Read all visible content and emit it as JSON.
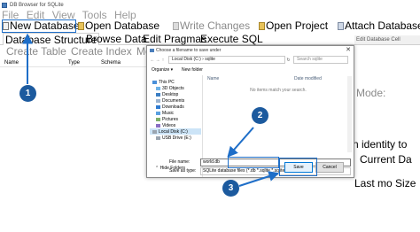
{
  "window": {
    "title": "DB Browser for SQLite"
  },
  "menubar": [
    "File",
    "Edit",
    "View",
    "Tools",
    "Help"
  ],
  "toolbar": {
    "new_database": "New Database",
    "open_database": "Open Database",
    "write_changes": "Write Changes",
    "open_project": "Open Project",
    "attach_database": "Attach Database"
  },
  "tabs": [
    "Database Structure",
    "Browse Data",
    "Edit Pragmas",
    "Execute SQL"
  ],
  "subtoolbar": {
    "create_table": "Create Table",
    "create_index": "Create Index",
    "modify": "Mo"
  },
  "columns": {
    "name": "Name",
    "type": "Type",
    "schema": "Schema"
  },
  "right_pane": {
    "header": "Edit Database Cell",
    "frag_mode": "Mode:",
    "frag_identity": "n identity to",
    "frag_current": "Current Da",
    "frag_last": "Last mo Size"
  },
  "dialog": {
    "title": "Choose a filename to save under",
    "path": "Local Disk (C:) › sqlite",
    "search_placeholder": "Search sqlite",
    "organize": "Organize ▾",
    "new_folder": "New folder",
    "nav_items": [
      "This PC",
      "3D Objects",
      "Desktop",
      "Documents",
      "Downloads",
      "Music",
      "Pictures",
      "Videos",
      "Local Disk (C:)",
      "USB Drive (E:)"
    ],
    "file_headers": {
      "name": "Name",
      "date_modified": "Date modified"
    },
    "empty_message": "No items match your search.",
    "file_name_label": "File name:",
    "file_name_value": "world.db",
    "save_as_type_label": "Save as type:",
    "save_as_type_value": "SQLite database files (*.db *.sqlite *.sqlite3 *.db3)",
    "hide_folders": "Hide Folders",
    "save_button": "Save",
    "cancel_button": "Cancel"
  },
  "annotations": {
    "step1": "1",
    "step2": "2",
    "step3": "3"
  },
  "colors": {
    "highlight": "#1e6ec8",
    "badge": "#1c5a9e",
    "selection": "#cce4f7"
  }
}
